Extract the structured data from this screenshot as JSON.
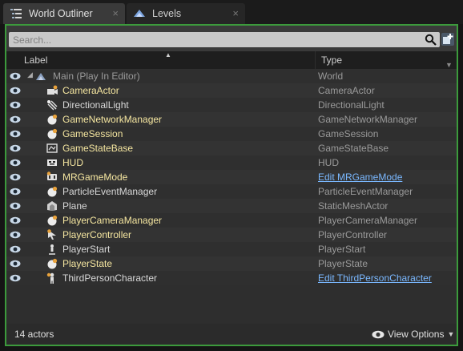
{
  "tabs": [
    {
      "label": "World Outliner",
      "icon": "outliner-list-icon",
      "active": true
    },
    {
      "label": "Levels",
      "icon": "levels-icon",
      "active": false
    }
  ],
  "tab_close": "×",
  "search": {
    "placeholder": "Search..."
  },
  "columns": {
    "label": "Label",
    "type": "Type"
  },
  "rows": [
    {
      "name": "Main (Play In Editor)",
      "type": "World",
      "icon": "world-icon",
      "type_is_link": false,
      "highlight": false
    },
    {
      "name": "CameraActor",
      "type": "CameraActor",
      "icon": "camera-actor-icon",
      "type_is_link": false,
      "highlight": true
    },
    {
      "name": "DirectionalLight",
      "type": "DirectionalLight",
      "icon": "directional-light-icon",
      "type_is_link": false,
      "highlight": false
    },
    {
      "name": "GameNetworkManager",
      "type": "GameNetworkManager",
      "icon": "sphere-actor-icon",
      "type_is_link": false,
      "highlight": true
    },
    {
      "name": "GameSession",
      "type": "GameSession",
      "icon": "sphere-actor-icon",
      "type_is_link": false,
      "highlight": true
    },
    {
      "name": "GameStateBase",
      "type": "GameStateBase",
      "icon": "game-state-icon",
      "type_is_link": false,
      "highlight": true
    },
    {
      "name": "HUD",
      "type": "HUD",
      "icon": "hud-icon",
      "type_is_link": false,
      "highlight": true
    },
    {
      "name": "MRGameMode",
      "type": "Edit MRGameMode",
      "icon": "game-mode-icon",
      "type_is_link": true,
      "highlight": true
    },
    {
      "name": "ParticleEventManager",
      "type": "ParticleEventManager",
      "icon": "sphere-actor-icon",
      "type_is_link": false,
      "highlight": false
    },
    {
      "name": "Plane",
      "type": "StaticMeshActor",
      "icon": "static-mesh-icon",
      "type_is_link": false,
      "highlight": false
    },
    {
      "name": "PlayerCameraManager",
      "type": "PlayerCameraManager",
      "icon": "sphere-actor-icon",
      "type_is_link": false,
      "highlight": true
    },
    {
      "name": "PlayerController",
      "type": "PlayerController",
      "icon": "player-controller-icon",
      "type_is_link": false,
      "highlight": true
    },
    {
      "name": "PlayerStart",
      "type": "PlayerStart",
      "icon": "player-start-icon",
      "type_is_link": false,
      "highlight": false
    },
    {
      "name": "PlayerState",
      "type": "PlayerState",
      "icon": "sphere-actor-icon",
      "type_is_link": false,
      "highlight": true
    },
    {
      "name": "ThirdPersonCharacter",
      "type": "Edit ThirdPersonCharacter",
      "icon": "character-icon",
      "type_is_link": true,
      "highlight": false
    }
  ],
  "footer": {
    "count": "14 actors",
    "view_options": "View Options"
  },
  "colors": {
    "accent_border": "#3c9a3c",
    "highlight_text": "#f5e6a0",
    "normal_text": "#d8d8d8",
    "link": "#7ab8ff",
    "dim_text": "#9a9a9a"
  }
}
